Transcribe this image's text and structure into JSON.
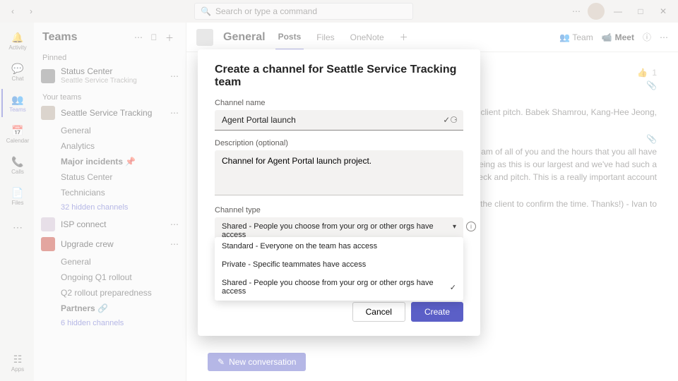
{
  "titlebar": {
    "search_placeholder": "Search or type a command"
  },
  "rail": {
    "activity": "Activity",
    "chat": "Chat",
    "teams": "Teams",
    "calendar": "Calendar",
    "calls": "Calls",
    "files": "Files",
    "apps": "Apps"
  },
  "teams_panel": {
    "title": "Teams",
    "pinned_label": "Pinned",
    "pinned_team": "Status Center",
    "pinned_sub": "Seattle Service Tracking",
    "your_teams_label": "Your teams",
    "team1": {
      "name": "Seattle Service Tracking",
      "channels": [
        "General",
        "Analytics",
        "Major incidents",
        "Status Center",
        "Technicians"
      ],
      "hidden": "32 hidden channels"
    },
    "team2": {
      "name": "ISP connect"
    },
    "team3": {
      "name": "Upgrade crew",
      "channels": [
        "General",
        "Ongoing Q1 rollout",
        "Q2 rollout preparedness",
        "Partners"
      ],
      "hidden": "6 hidden channels"
    }
  },
  "channel_header": {
    "name": "General",
    "tabs": {
      "posts": "Posts",
      "files": "Files",
      "onenote": "OneNote"
    },
    "team_btn": "Team",
    "meet_btn": "Meet"
  },
  "convo": {
    "like_count": "1",
    "snippet1": "he client pitch. Babek Shamrou, Kang-Hee Jeong,",
    "snippet2": "I am of all of you and the hours that you all have",
    "snippet3": "seing as this is our largest and we've had such a",
    "snippet4": "your deck and pitch. This is a really important account",
    "snippet5": "for the client to confirm the time. Thanks!) - Ivan to",
    "new_conversation": "New conversation"
  },
  "modal": {
    "title": "Create a channel for Seattle Service Tracking team",
    "name_label": "Channel name",
    "name_value": "Agent Portal launch",
    "desc_label": "Description (optional)",
    "desc_value": "Channel for Agent Portal launch project.",
    "type_label": "Channel type",
    "type_value": "Shared - People you choose from your org or other orgs have access",
    "options": {
      "standard": "Standard - Everyone on the team has access",
      "private": "Private - Specific teammates have access",
      "shared": "Shared - People you choose from your org or other orgs have access"
    },
    "cancel": "Cancel",
    "create": "Create"
  }
}
